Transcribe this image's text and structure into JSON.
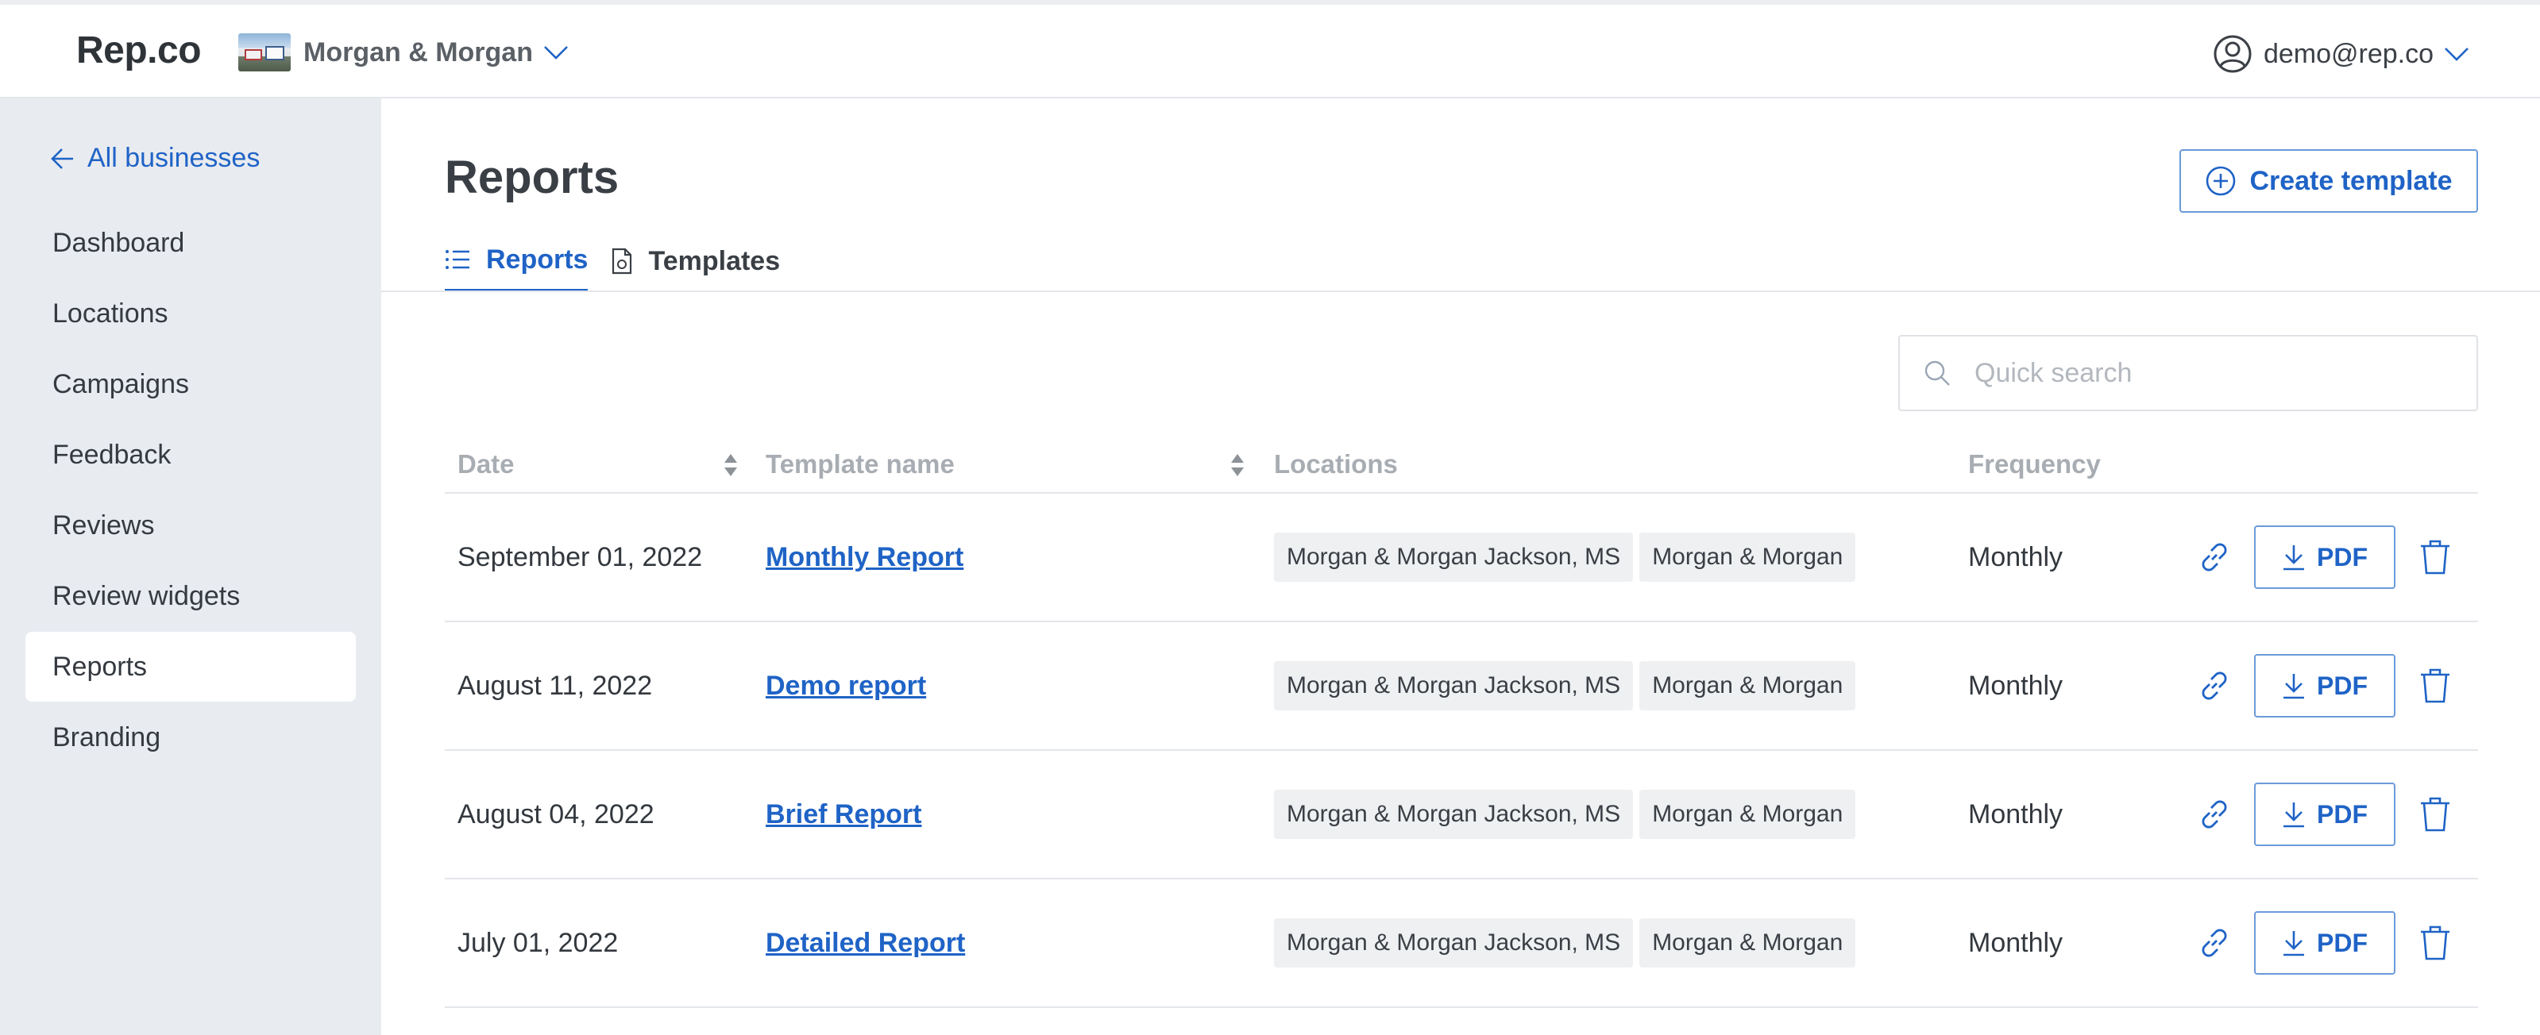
{
  "header": {
    "logo": "Rep.co",
    "business_name": "Morgan & Morgan",
    "user_email": "demo@rep.co"
  },
  "sidebar": {
    "back_label": "All businesses",
    "items": [
      {
        "label": "Dashboard"
      },
      {
        "label": "Locations"
      },
      {
        "label": "Campaigns"
      },
      {
        "label": "Feedback"
      },
      {
        "label": "Reviews"
      },
      {
        "label": "Review widgets"
      },
      {
        "label": "Reports",
        "active": true
      },
      {
        "label": "Branding"
      }
    ]
  },
  "main": {
    "title": "Reports",
    "create_button": "Create template",
    "tabs": [
      {
        "label": "Reports",
        "active": true
      },
      {
        "label": "Templates",
        "active": false
      }
    ],
    "search_placeholder": "Quick search"
  },
  "table": {
    "columns": {
      "date": "Date",
      "template_name": "Template name",
      "locations": "Locations",
      "frequency": "Frequency"
    },
    "pdf_label": "PDF",
    "rows": [
      {
        "date": "September 01, 2022",
        "name": "Monthly Report",
        "locations": [
          "Morgan & Morgan Jackson, MS",
          "Morgan & Morgan"
        ],
        "frequency": "Monthly"
      },
      {
        "date": "August 11, 2022",
        "name": "Demo report",
        "locations": [
          "Morgan & Morgan Jackson, MS",
          "Morgan & Morgan"
        ],
        "frequency": "Monthly"
      },
      {
        "date": "August 04, 2022",
        "name": "Brief Report",
        "locations": [
          "Morgan & Morgan Jackson, MS",
          "Morgan & Morgan"
        ],
        "frequency": "Monthly"
      },
      {
        "date": "July 01, 2022",
        "name": "Detailed Report",
        "locations": [
          "Morgan & Morgan Jackson, MS",
          "Morgan & Morgan"
        ],
        "frequency": "Monthly"
      }
    ]
  },
  "colors": {
    "accent": "#1f63c6",
    "sidebar_bg": "#e8ebf0",
    "divider": "#e3e6ea"
  }
}
